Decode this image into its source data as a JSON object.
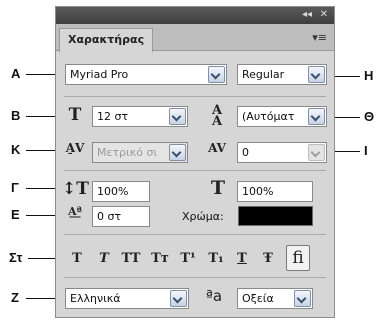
{
  "panel": {
    "window_controls": {
      "collapse": "◂◂",
      "close": "✕"
    },
    "tab_label": "Χαρακτήρας",
    "menu_icon": "panel-menu-icon"
  },
  "callouts": [
    "A",
    "B",
    "K",
    "Γ",
    "E",
    "Στ",
    "Z",
    "H",
    "Θ",
    "I"
  ],
  "font": {
    "family": "Myriad Pro",
    "style": "Regular",
    "size": "12 στ",
    "leading": "(Αυτόματ",
    "kerning": "Μετρικό σι",
    "tracking": "0",
    "vertical_scale": "100%",
    "horizontal_scale": "100%",
    "baseline_shift": "0 στ",
    "color_label": "Χρώμα:",
    "color_value": "#000000"
  },
  "style_buttons": [
    {
      "name": "faux-bold-button",
      "label": "T"
    },
    {
      "name": "faux-italic-button",
      "label": "T"
    },
    {
      "name": "all-caps-button",
      "label": "TT"
    },
    {
      "name": "small-caps-button",
      "label": "Tт"
    },
    {
      "name": "superscript-button",
      "label": "T¹"
    },
    {
      "name": "subscript-button",
      "label": "T₁"
    },
    {
      "name": "underline-button",
      "label": "T"
    },
    {
      "name": "strikethrough-button",
      "label": "Ŧ"
    },
    {
      "name": "ligatures-button",
      "label": "fi"
    }
  ],
  "language": {
    "value": "Ελληνικά",
    "aa_icon": "ªa",
    "anti_alias": "Οξεία"
  }
}
